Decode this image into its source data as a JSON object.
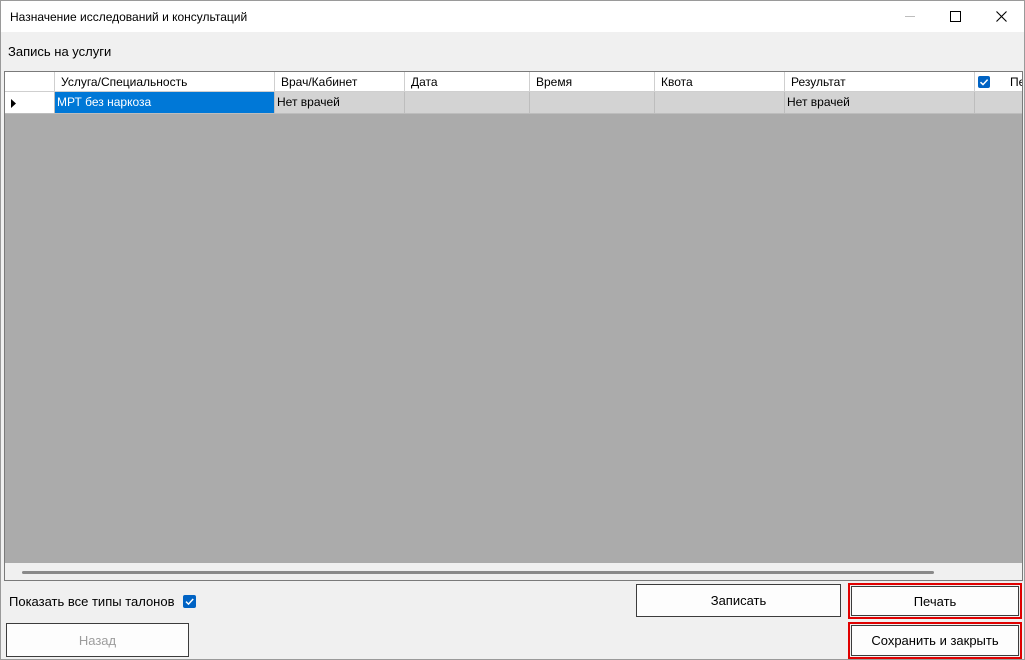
{
  "window": {
    "title": "Назначение исследований и консультаций"
  },
  "section": {
    "label": "Запись на услуги"
  },
  "grid": {
    "columns": [
      "Услуга/Специальность",
      "Врач/Кабинет",
      "Дата",
      "Время",
      "Квота",
      "Результат",
      "Пе"
    ],
    "select_all_checked": true,
    "rows": [
      {
        "service": "МРТ без наркоза",
        "doctor": "Нет врачей",
        "date": "",
        "time": "",
        "quota": "",
        "result": "Нет врачей",
        "print": ""
      }
    ]
  },
  "options": {
    "show_all_ticket_types_label": "Показать все типы талонов",
    "show_all_ticket_types_checked": true
  },
  "buttons": {
    "book_label": "Записать",
    "print_label": "Печать",
    "save_close_label": "Сохранить и закрыть",
    "back_label": "Назад"
  },
  "colors": {
    "selection": "#0078d7",
    "highlight": "#e00000",
    "grid_background": "#ababab",
    "checkbox": "#0063c4"
  }
}
